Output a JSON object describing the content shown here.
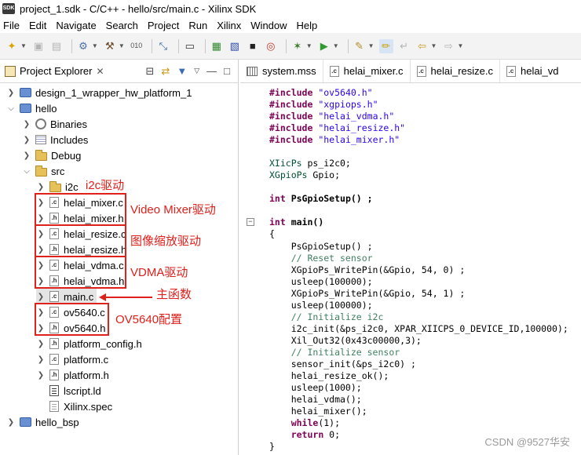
{
  "window": {
    "app_icon_text": "SDK",
    "title": "project_1.sdk - C/C++ - hello/src/main.c - Xilinx SDK"
  },
  "menu": [
    "File",
    "Edit",
    "Navigate",
    "Search",
    "Project",
    "Run",
    "Xilinx",
    "Window",
    "Help"
  ],
  "toolbar": {
    "icons": [
      "new-icon",
      "save-icon",
      "save-all-icon",
      "settings-icon",
      "build-icon",
      "binary-icon",
      "debug-icon",
      "terminal-icon",
      "program-fpga-icon",
      "xsct-icon",
      "launch-icon",
      "run-icon",
      "tool-icon",
      "highlight-icon",
      "back-icon",
      "forward-icon"
    ]
  },
  "project_explorer": {
    "tab_label": "Project Explorer",
    "tab_close": "✕",
    "tree": [
      {
        "label": "design_1_wrapper_hw_platform_1",
        "type": "project"
      },
      {
        "label": "hello",
        "type": "project"
      },
      {
        "label": "Binaries",
        "type": "binaries"
      },
      {
        "label": "Includes",
        "type": "includes"
      },
      {
        "label": "Debug",
        "type": "folder"
      },
      {
        "label": "src",
        "type": "folder"
      },
      {
        "label": "i2c",
        "type": "folder"
      },
      {
        "label": "helai_mixer.c",
        "type": "c"
      },
      {
        "label": "helai_mixer.h",
        "type": "h"
      },
      {
        "label": "helai_resize.c",
        "type": "c"
      },
      {
        "label": "helai_resize.h",
        "type": "h"
      },
      {
        "label": "helai_vdma.c",
        "type": "c"
      },
      {
        "label": "helai_vdma.h",
        "type": "h"
      },
      {
        "label": "main.c",
        "type": "c"
      },
      {
        "label": "ov5640.c",
        "type": "c"
      },
      {
        "label": "ov5640.h",
        "type": "h"
      },
      {
        "label": "platform_config.h",
        "type": "h"
      },
      {
        "label": "platform.c",
        "type": "c"
      },
      {
        "label": "platform.h",
        "type": "h"
      },
      {
        "label": "lscript.ld",
        "type": "ld"
      },
      {
        "label": "Xilinx.spec",
        "type": "spec"
      },
      {
        "label": "hello_bsp",
        "type": "project"
      }
    ],
    "annotations": {
      "i2c": "i2c驱动",
      "mixer": "Video Mixer驱动",
      "resize": "图像缩放驱动",
      "vdma": "VDMA驱动",
      "main": "主函数",
      "ov5640": "OV5640配置"
    }
  },
  "editor": {
    "tabs": [
      "system.mss",
      "helai_mixer.c",
      "helai_resize.c",
      "helai_vd"
    ],
    "code": {
      "l1_kw": "#include",
      "l1_s": "\"ov5640.h\"",
      "l2_kw": "#include",
      "l2_s": "\"xgpiops.h\"",
      "l3_kw": "#include",
      "l3_s": "\"helai_vdma.h\"",
      "l4_kw": "#include",
      "l4_s": "\"helai_resize.h\"",
      "l5_kw": "#include",
      "l5_s": "\"helai_mixer.h\"",
      "l6_t": "XIicPs",
      "l6_r": " ps_i2c0;",
      "l7_t": "XGpioPs",
      "l7_r": " Gpio;",
      "l8_kw": "int",
      "l8_r": " PsGpioSetup() ;",
      "l9_kw": "int",
      "l9_r": " main()",
      "l10": "{",
      "l11": "    PsGpioSetup() ;",
      "l12": "    // Reset sensor",
      "l13": "    XGpioPs_WritePin(&Gpio, 54, 0) ;",
      "l14": "    usleep(100000);",
      "l15": "    XGpioPs_WritePin(&Gpio, 54, 1) ;",
      "l16": "    usleep(100000);",
      "l17": "    // Initialize i2c",
      "l18": "    i2c_init(&ps_i2c0, XPAR_XIICPS_0_DEVICE_ID,100000);",
      "l19": "    Xil_Out32(0x43c00000,3);",
      "l20": "    // Initialize sensor",
      "l21": "    sensor_init(&ps_i2c0) ;",
      "l22": "    helai_resize_ok();",
      "l23": "    usleep(1000);",
      "l24": "    helai_vdma();",
      "l25": "    helai_mixer();",
      "l26_kw": "while",
      "l26_r": "(1);",
      "l27_kw": "return",
      "l27_r": " 0;",
      "l28": "}"
    }
  },
  "watermark": "CSDN @9527华安"
}
